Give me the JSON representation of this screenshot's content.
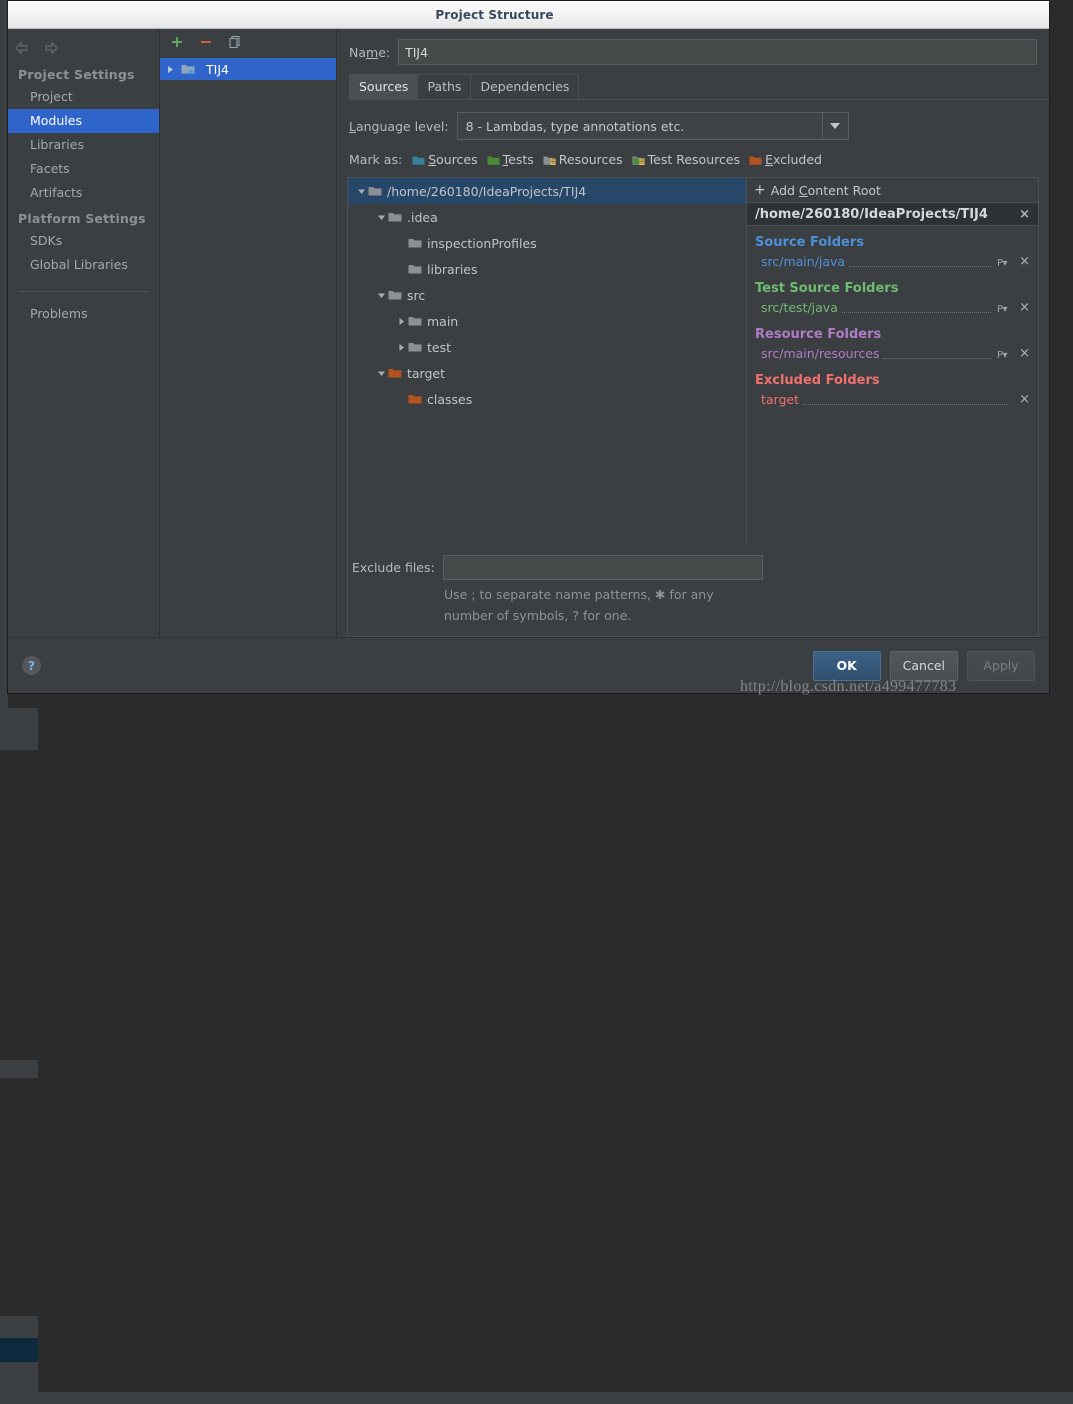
{
  "window": {
    "title": "Project Structure"
  },
  "sidebar": {
    "nav": {
      "back": "back-arrow",
      "forward": "forward-arrow"
    },
    "groups": [
      {
        "label": "Project Settings",
        "items": [
          {
            "label": "Project",
            "selected": false
          },
          {
            "label": "Modules",
            "selected": true
          },
          {
            "label": "Libraries",
            "selected": false
          },
          {
            "label": "Facets",
            "selected": false
          },
          {
            "label": "Artifacts",
            "selected": false
          }
        ]
      },
      {
        "label": "Platform Settings",
        "items": [
          {
            "label": "SDKs",
            "selected": false
          },
          {
            "label": "Global Libraries",
            "selected": false
          }
        ]
      }
    ],
    "extra": [
      {
        "label": "Problems"
      }
    ]
  },
  "modules_panel": {
    "toolbar": [
      {
        "name": "add-module-button",
        "glyph": "+"
      },
      {
        "name": "remove-module-button",
        "glyph": "−"
      },
      {
        "name": "copy-module-button",
        "glyph": "copy"
      }
    ],
    "tree": [
      {
        "label": "TIJ4",
        "selected": true,
        "expanded": false
      }
    ]
  },
  "main": {
    "name_label": "Name:",
    "name_mnemonic": "m",
    "name_value": "TIJ4",
    "tabs": [
      {
        "label": "Sources",
        "active": true
      },
      {
        "label": "Paths",
        "active": false
      },
      {
        "label": "Dependencies",
        "active": false
      }
    ],
    "language_level": {
      "label": "Language level:",
      "value": "8 - Lambdas, type annotations etc."
    },
    "mark_as": {
      "label": "Mark as:",
      "options": [
        {
          "label": "Sources",
          "color": "#3a7e9b"
        },
        {
          "label": "Tests",
          "color": "#4a8b3a"
        },
        {
          "label": "Resources",
          "color": "#8b9094"
        },
        {
          "label": "Test Resources",
          "color": "#8b9094"
        },
        {
          "label": "Excluded",
          "color": "#b4531f"
        }
      ]
    },
    "filetree": [
      {
        "label": "/home/260180/IdeaProjects/TIJ4",
        "indent": 0,
        "twisty": "down",
        "color": "#c0c4c8",
        "icon": "#8b9094",
        "selected": true
      },
      {
        "label": ".idea",
        "indent": 1,
        "twisty": "down",
        "color": "#c0c4c8",
        "icon": "#8b9094",
        "selected": false
      },
      {
        "label": "inspectionProfiles",
        "indent": 2,
        "twisty": "none",
        "color": "#c0c4c8",
        "icon": "#8b9094",
        "selected": false
      },
      {
        "label": "libraries",
        "indent": 2,
        "twisty": "none",
        "color": "#c0c4c8",
        "icon": "#8b9094",
        "selected": false
      },
      {
        "label": "src",
        "indent": 1,
        "twisty": "down",
        "color": "#c0c4c8",
        "icon": "#8b9094",
        "selected": false
      },
      {
        "label": "main",
        "indent": 2,
        "twisty": "right",
        "color": "#c0c4c8",
        "icon": "#8b9094",
        "selected": false
      },
      {
        "label": "test",
        "indent": 2,
        "twisty": "right",
        "color": "#c0c4c8",
        "icon": "#8b9094",
        "selected": false
      },
      {
        "label": "target",
        "indent": 1,
        "twisty": "down",
        "color": "#c0c4c8",
        "icon": "#b4531f",
        "selected": false
      },
      {
        "label": "classes",
        "indent": 2,
        "twisty": "none",
        "color": "#c0c4c8",
        "icon": "#b4531f",
        "selected": false
      }
    ],
    "roots": {
      "add_label": "Add Content Root",
      "add_mnemonic": "C",
      "root_path": "/home/260180/IdeaProjects/TIJ4",
      "close_glyph": "×",
      "groups": [
        {
          "title": "Source Folders",
          "color": "#4e90d8",
          "folders": [
            {
              "path": "src/main/java",
              "prefix_button": "P",
              "close": "×"
            }
          ]
        },
        {
          "title": "Test Source Folders",
          "color": "#6fbb72",
          "folders": [
            {
              "path": "src/test/java",
              "prefix_button": "P",
              "close": "×"
            }
          ]
        },
        {
          "title": "Resource Folders",
          "color": "#b07cc6",
          "folders": [
            {
              "path": "src/main/resources",
              "prefix_button": "P",
              "close": "×"
            }
          ]
        },
        {
          "title": "Excluded Folders",
          "color": "#f07070",
          "folders": [
            {
              "path": "target",
              "prefix_button": "",
              "close": "×"
            }
          ]
        }
      ]
    },
    "exclude": {
      "label": "Exclude files:",
      "value": "",
      "placeholder": "",
      "hint_line1": "Use ; to separate name patterns, ✱ for any",
      "hint_line2": "number of symbols, ? for one."
    }
  },
  "footer": {
    "help_glyph": "?",
    "buttons": [
      {
        "label": "OK",
        "style": "primary"
      },
      {
        "label": "Cancel",
        "style": "normal"
      },
      {
        "label": "Apply",
        "style": "disabled"
      }
    ]
  },
  "watermark": "http://blog.csdn.net/a499477783"
}
